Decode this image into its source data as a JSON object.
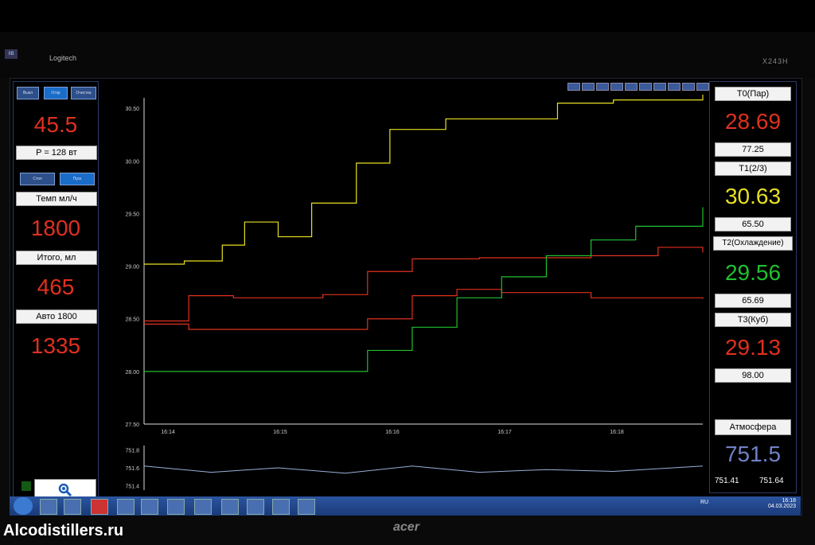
{
  "monitor": {
    "brand_logo": "Logitech",
    "model": "X243H",
    "watermark": "Alcodistillers.ru",
    "bezel_brand": "acer"
  },
  "left": {
    "top_buttons": [
      "Выкл",
      "Откр",
      "Очистка"
    ],
    "power_value": "45.5",
    "power_label": "P = 128 вт",
    "mid_buttons": [
      "Стоп",
      "Пуск"
    ],
    "rate_label": "Темп мл/ч",
    "rate_value": "1800",
    "total_label": "Итого, мл",
    "total_value": "465",
    "auto_label": "Авто 1800",
    "auto_value": "1335"
  },
  "right": {
    "t0_label": "T0(Пар)",
    "t0_value": "28.69",
    "t0_sub": "77.25",
    "t1_label": "T1(2/3)",
    "t1_value": "30.63",
    "t1_sub": "65.50",
    "t2_label": "T2(Охлаждение)",
    "t2_value": "29.56",
    "t2_sub": "65.69",
    "t3_label": "T3(Куб)",
    "t3_value": "29.13",
    "t3_sub": "98.00",
    "atm_label": "Атмосфера",
    "atm_value": "751.5",
    "atm_min": "751.41",
    "atm_max": "751.64"
  },
  "taskbar": {
    "lang": "RU",
    "time": "16:18",
    "date": "04.03.2023"
  },
  "colors": {
    "red": "#e03020",
    "yellow": "#e8e020",
    "green": "#20c030",
    "blue": "#6f82c8"
  },
  "chart_data": [
    {
      "type": "line",
      "yticks": [
        "30.50",
        "30.00",
        "29.50",
        "29.00",
        "28.50",
        "28.00",
        "27.50"
      ],
      "xticks": [
        "16:14",
        "16:15",
        "16:16",
        "16:17",
        "16:18"
      ],
      "ylim": [
        27.5,
        30.6
      ],
      "series": [
        {
          "color": "#e8e020",
          "x": [
            0,
            1.8,
            3.5,
            4.5,
            6.0,
            7.5,
            9.5,
            11.0,
            13.5,
            16.5,
            18.5,
            21.0,
            25.0
          ],
          "y": [
            29.02,
            29.05,
            29.2,
            29.42,
            29.28,
            29.6,
            29.98,
            30.3,
            30.4,
            30.4,
            30.55,
            30.58,
            30.63
          ]
        },
        {
          "color": "#e03020",
          "x": [
            0,
            2.0,
            4.0,
            8.0,
            10.0,
            12.0,
            15.0,
            20.0,
            23.0,
            25.0
          ],
          "y": [
            28.48,
            28.72,
            28.7,
            28.73,
            28.95,
            29.07,
            29.08,
            29.1,
            29.18,
            29.13
          ]
        },
        {
          "color": "#e03020",
          "x": [
            0,
            2.0,
            7.0,
            10.0,
            12.0,
            14.0,
            16.0,
            20.0,
            25.0
          ],
          "y": [
            28.45,
            28.4,
            28.4,
            28.5,
            28.72,
            28.78,
            28.75,
            28.7,
            28.69
          ]
        },
        {
          "color": "#20c030",
          "x": [
            0,
            8.0,
            10.0,
            12.0,
            14.0,
            16.0,
            18.0,
            20.0,
            22.0,
            25.0
          ],
          "y": [
            28.0,
            28.0,
            28.2,
            28.42,
            28.7,
            28.9,
            29.1,
            29.25,
            29.38,
            29.56
          ]
        }
      ]
    },
    {
      "type": "line",
      "yticks": [
        "751.8",
        "751.6",
        "751.4"
      ],
      "ylim": [
        751.35,
        751.85
      ],
      "series": [
        {
          "color": "#9ab0d8",
          "x": [
            0,
            3,
            6,
            9,
            12,
            15,
            18,
            21,
            25
          ],
          "y": [
            751.62,
            751.55,
            751.6,
            751.54,
            751.62,
            751.55,
            751.58,
            751.56,
            751.62
          ]
        }
      ]
    }
  ]
}
